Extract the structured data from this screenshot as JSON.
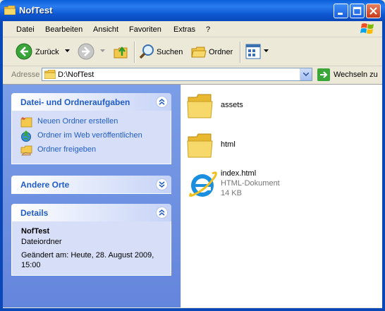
{
  "window": {
    "title": "NofTest",
    "title_color": "#0a5fd8"
  },
  "menu": [
    "Datei",
    "Bearbeiten",
    "Ansicht",
    "Favoriten",
    "Extras",
    "?"
  ],
  "toolbar": {
    "back_label": "Zurück",
    "search_label": "Suchen",
    "folders_label": "Ordner"
  },
  "address": {
    "label": "Adresse",
    "value": "D:\\NofTest",
    "go_label": "Wechseln zu"
  },
  "tasks_panel": {
    "title": "Datei- und Ordneraufgaben",
    "items": [
      {
        "label": "Neuen Ordner erstellen",
        "icon": "new-folder-icon"
      },
      {
        "label": "Ordner im Web veröffentlichen",
        "icon": "publish-web-icon"
      },
      {
        "label": "Ordner freigeben",
        "icon": "share-folder-icon"
      }
    ]
  },
  "places_panel": {
    "title": "Andere Orte"
  },
  "details_panel": {
    "title": "Details",
    "name": "NofTest",
    "type": "Dateiordner",
    "modified": "Geändert am: Heute, 28. August 2009, 15:00"
  },
  "files": [
    {
      "name": "assets",
      "icon": "folder-icon"
    },
    {
      "name": "html",
      "icon": "folder-icon"
    },
    {
      "name": "index.html",
      "type": "HTML-Dokument",
      "size": "14 KB",
      "icon": "ie-html-icon"
    }
  ],
  "colors": {
    "link": "#215dc6",
    "sidebar": "#7b9ee7",
    "panel_body": "#d6dff7"
  }
}
